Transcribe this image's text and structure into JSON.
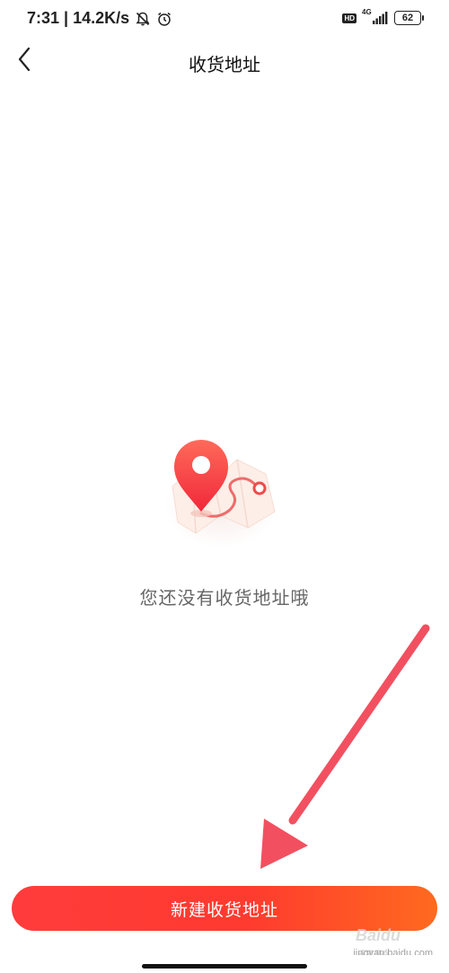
{
  "status_bar": {
    "time_speed": "7:31 | 14.2K/s",
    "hd_badge": "HD",
    "network_type": "4G",
    "battery_level": "62"
  },
  "nav": {
    "title": "收货地址"
  },
  "empty_state": {
    "message": "您还没有收货地址哦"
  },
  "footer": {
    "new_address_label": "新建收货地址"
  },
  "watermark": {
    "logo_text": "Baidu经验",
    "url": "jingyan.baidu.com"
  },
  "colors": {
    "accent": "#ff3b30",
    "annotation_arrow": "#f25060"
  },
  "icons": {
    "back": "chevron-left-icon",
    "mute": "bell-off-icon",
    "alarm": "alarm-clock-icon",
    "signal": "signal-bars-icon",
    "battery": "battery-icon",
    "illustration": "map-location-pin-icon"
  }
}
